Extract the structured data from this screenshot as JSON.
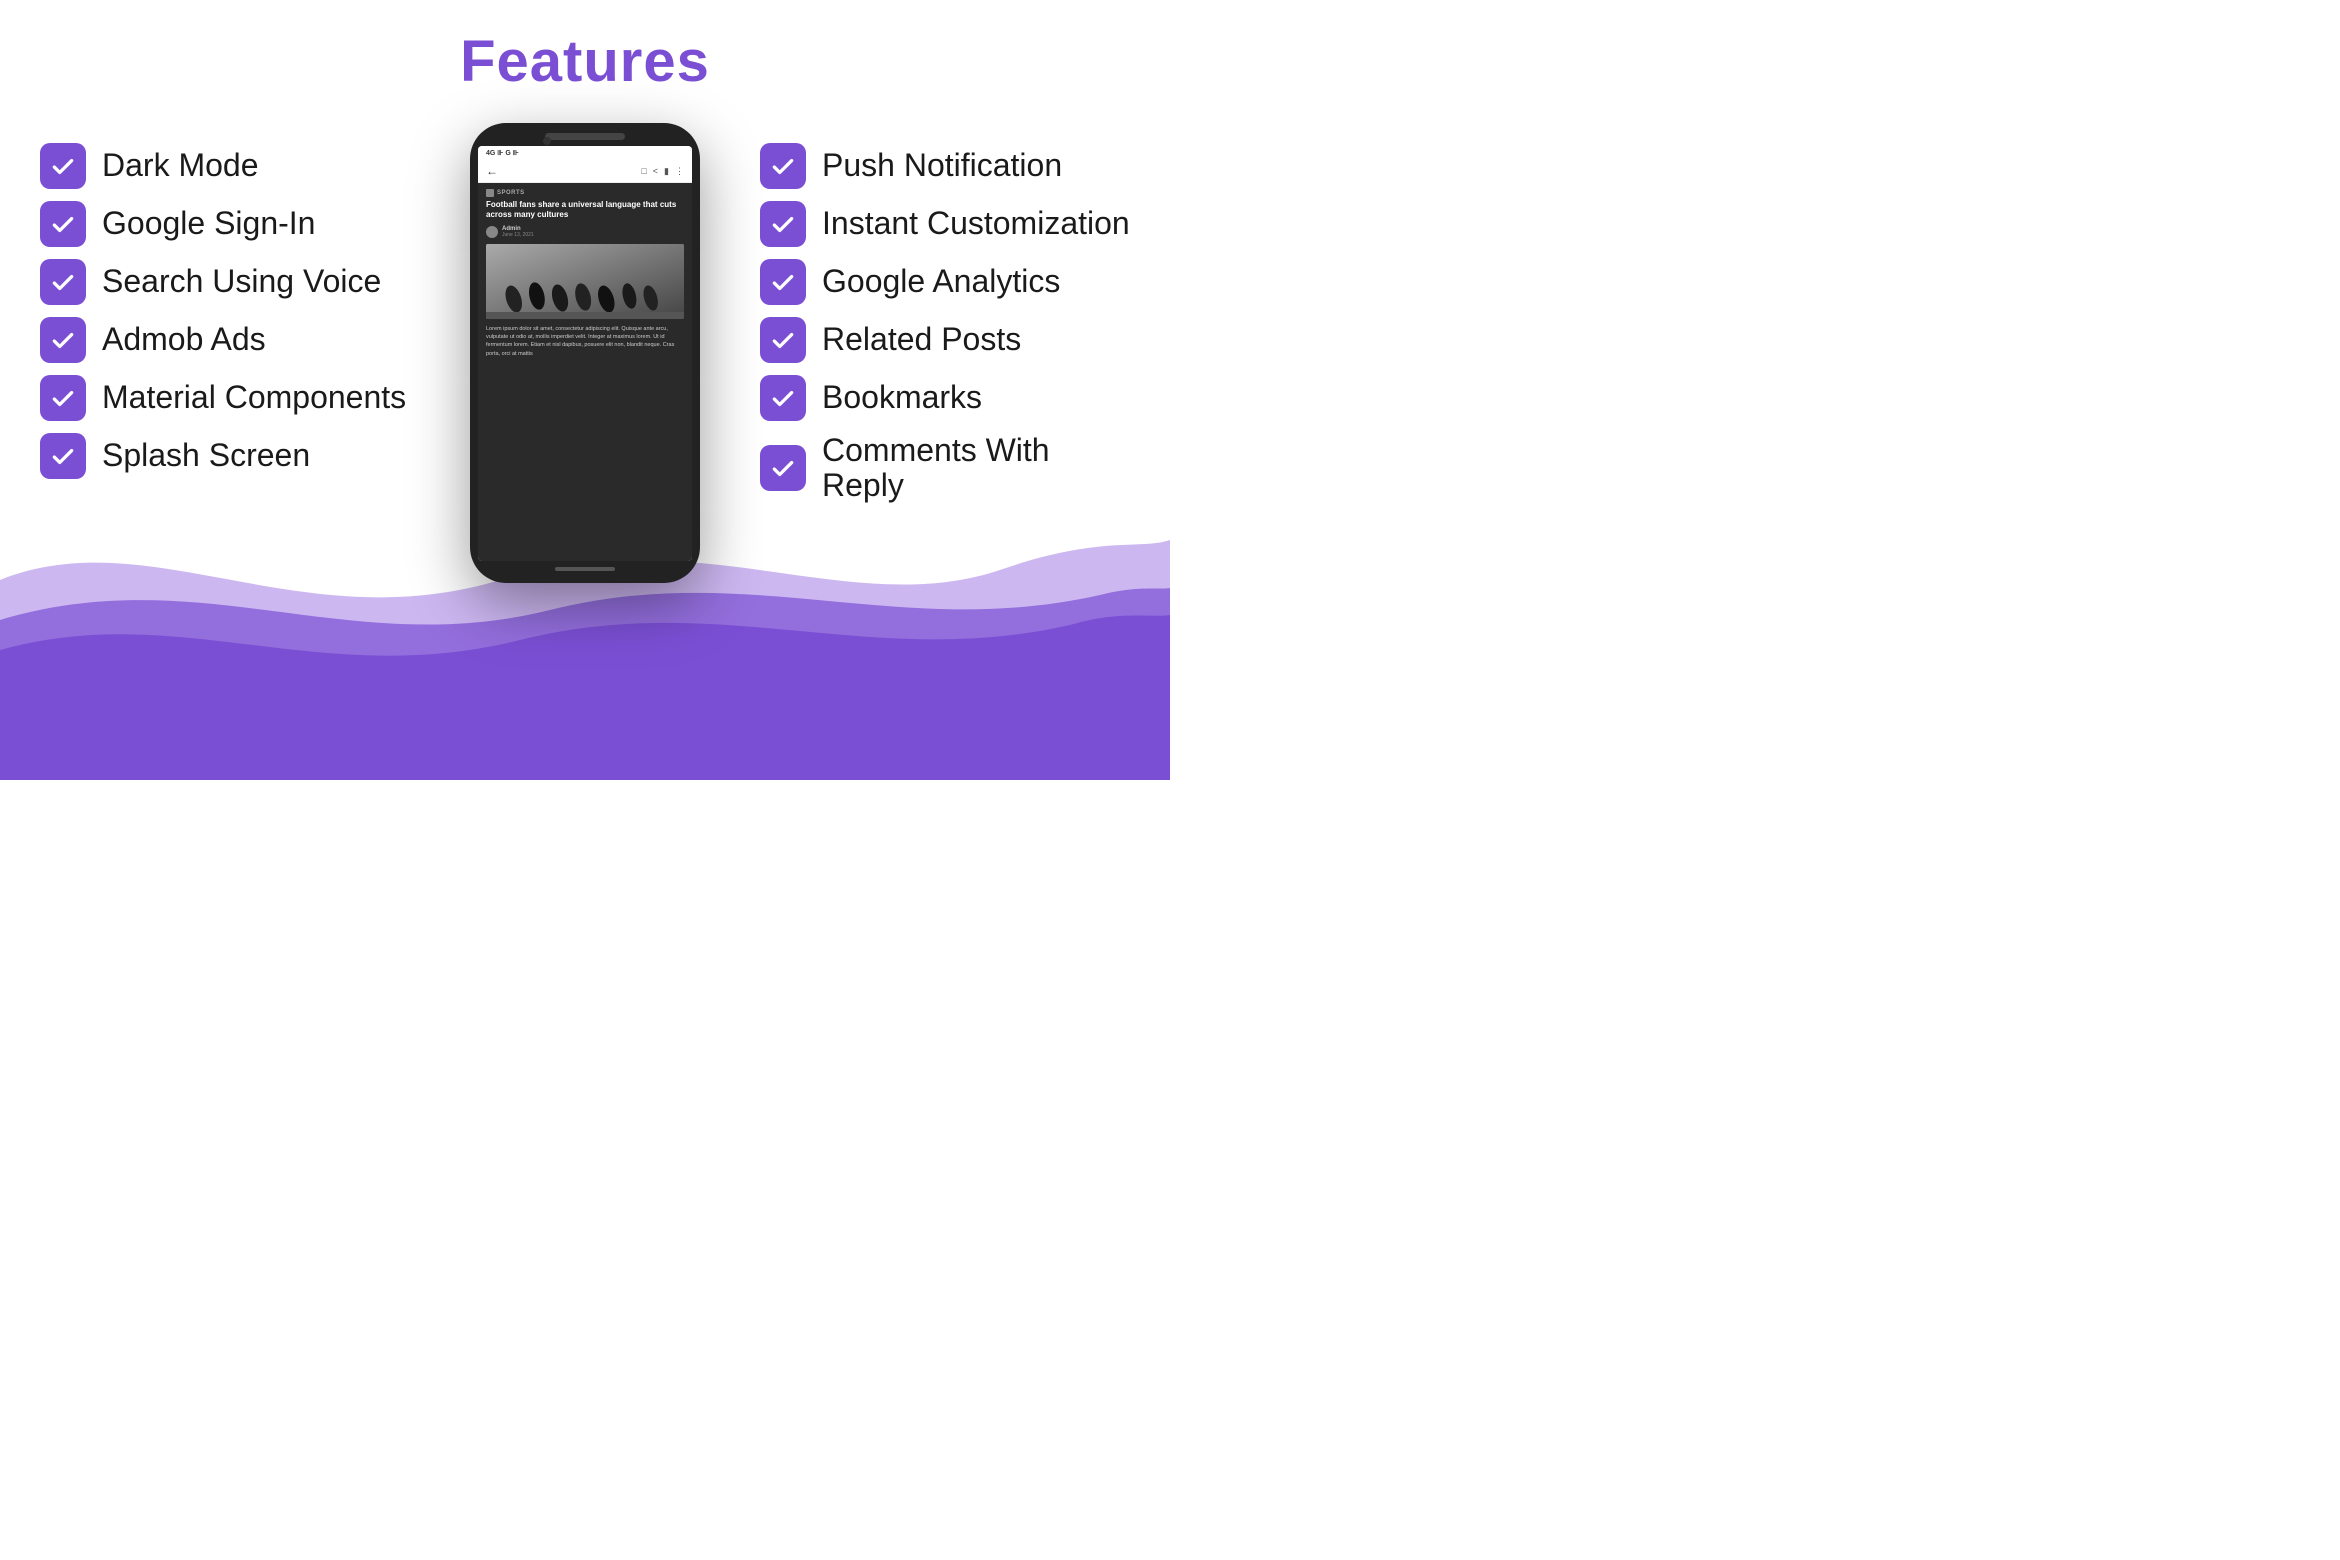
{
  "page": {
    "title": "Features",
    "background_wave_color_main": "#7B4FD4",
    "background_wave_color_light": "#9B6FE4"
  },
  "features_left": [
    {
      "id": "dark-mode",
      "label": "Dark Mode"
    },
    {
      "id": "google-signin",
      "label": "Google Sign-In"
    },
    {
      "id": "search-voice",
      "label": "Search Using Voice"
    },
    {
      "id": "admob-ads",
      "label": "Admob Ads"
    },
    {
      "id": "material-components",
      "label": "Material Components"
    },
    {
      "id": "splash-screen",
      "label": "Splash Screen"
    }
  ],
  "features_right": [
    {
      "id": "push-notification",
      "label": "Push Notification"
    },
    {
      "id": "instant-customization",
      "label": "Instant Customization"
    },
    {
      "id": "google-analytics",
      "label": "Google Analytics"
    },
    {
      "id": "related-posts",
      "label": "Related Posts"
    },
    {
      "id": "bookmarks",
      "label": "Bookmarks"
    },
    {
      "id": "comments-reply",
      "label": "Comments With Reply"
    }
  ],
  "phone": {
    "status_bar": "4G ⊪  G ⊪",
    "category": "SPORTS",
    "headline": "Football fans share a universal language that cuts across many cultures",
    "author_name": "Admin",
    "author_date": "June 13, 2021",
    "body_text": "Lorem ipsum dolor sit amet, consectetur adipiscing elit. Quisque ante arcu, vulputate ut odio at, mollis imperdiet velit. Integer at maximus lorem. Ut id fermentum lorem. Etiam et nisl dapibus, posuere elit non, blandit neque. Cras porta, orci at mattis"
  }
}
